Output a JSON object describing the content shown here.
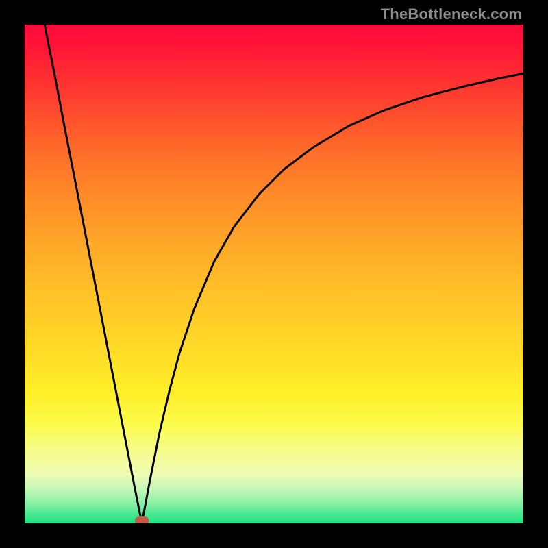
{
  "domain": "Chart",
  "watermark": "TheBottleneck.com",
  "colors": {
    "frame": "#000000",
    "curve": "#000000",
    "marker": "#c55a49",
    "gradient_top": "#ff0a3a",
    "gradient_mid": "#ffd927",
    "gradient_bottom": "#1ee183"
  },
  "chart_data": {
    "type": "line",
    "title": "",
    "xlabel": "",
    "ylabel": "",
    "xlim": [
      0,
      100
    ],
    "ylim": [
      0,
      100
    ],
    "grid": false,
    "legend": false,
    "annotations": [],
    "series": [
      {
        "name": "left-branch",
        "x": [
          4,
          6,
          8,
          10,
          12,
          14,
          16,
          18,
          20,
          22,
          23.5
        ],
        "values": [
          100,
          90,
          79.5,
          69.3,
          59,
          48.7,
          38.4,
          28.1,
          17.8,
          7.5,
          0
        ]
      },
      {
        "name": "right-branch",
        "x": [
          23.5,
          25,
          27,
          29,
          31,
          34,
          38,
          42,
          47,
          52,
          58,
          65,
          72,
          80,
          88,
          95,
          100
        ],
        "values": [
          0,
          8,
          18,
          26.5,
          34,
          43,
          52.5,
          59.5,
          66,
          71,
          75.5,
          79.7,
          82.8,
          85.5,
          87.6,
          89.2,
          90.2
        ]
      }
    ],
    "marker": {
      "x": 23.5,
      "y": 0,
      "label": ""
    }
  }
}
